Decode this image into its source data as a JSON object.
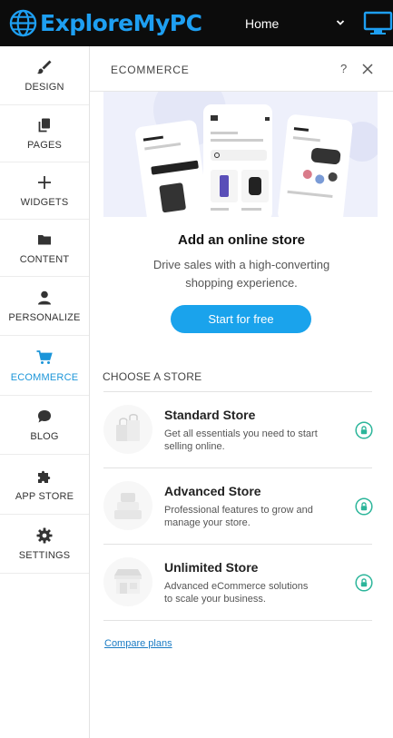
{
  "topbar": {
    "logo_text": "ExploreMyPC",
    "page_select": "Home"
  },
  "sidebar": {
    "items": [
      {
        "label": "DESIGN",
        "icon": "brush-icon"
      },
      {
        "label": "PAGES",
        "icon": "pages-icon"
      },
      {
        "label": "WIDGETS",
        "icon": "plus-icon"
      },
      {
        "label": "CONTENT",
        "icon": "folder-icon"
      },
      {
        "label": "PERSONALIZE",
        "icon": "person-icon"
      },
      {
        "label": "ECOMMERCE",
        "icon": "cart-icon",
        "active": true
      },
      {
        "label": "BLOG",
        "icon": "chat-icon"
      },
      {
        "label": "APP STORE",
        "icon": "puzzle-icon"
      },
      {
        "label": "SETTINGS",
        "icon": "gear-icon"
      }
    ]
  },
  "panel": {
    "title": "ECOMMERCE",
    "help": "?",
    "hero_title": "Add an online store",
    "hero_subtitle": "Drive sales with a high-converting shopping experience.",
    "cta": "Start for free",
    "choose_label": "CHOOSE A STORE",
    "stores": [
      {
        "name": "Standard Store",
        "desc": "Get all essentials you need to start selling online."
      },
      {
        "name": "Advanced Store",
        "desc": "Professional features to grow and manage your store."
      },
      {
        "name": "Unlimited Store",
        "desc": "Advanced eCommerce solutions to scale your business."
      }
    ],
    "compare_link": "Compare plans"
  },
  "colors": {
    "accent": "#1aa3ec",
    "active_nav": "#1b95d9",
    "lock_green": "#2bb59a",
    "topbar": "#0c0c0c"
  }
}
